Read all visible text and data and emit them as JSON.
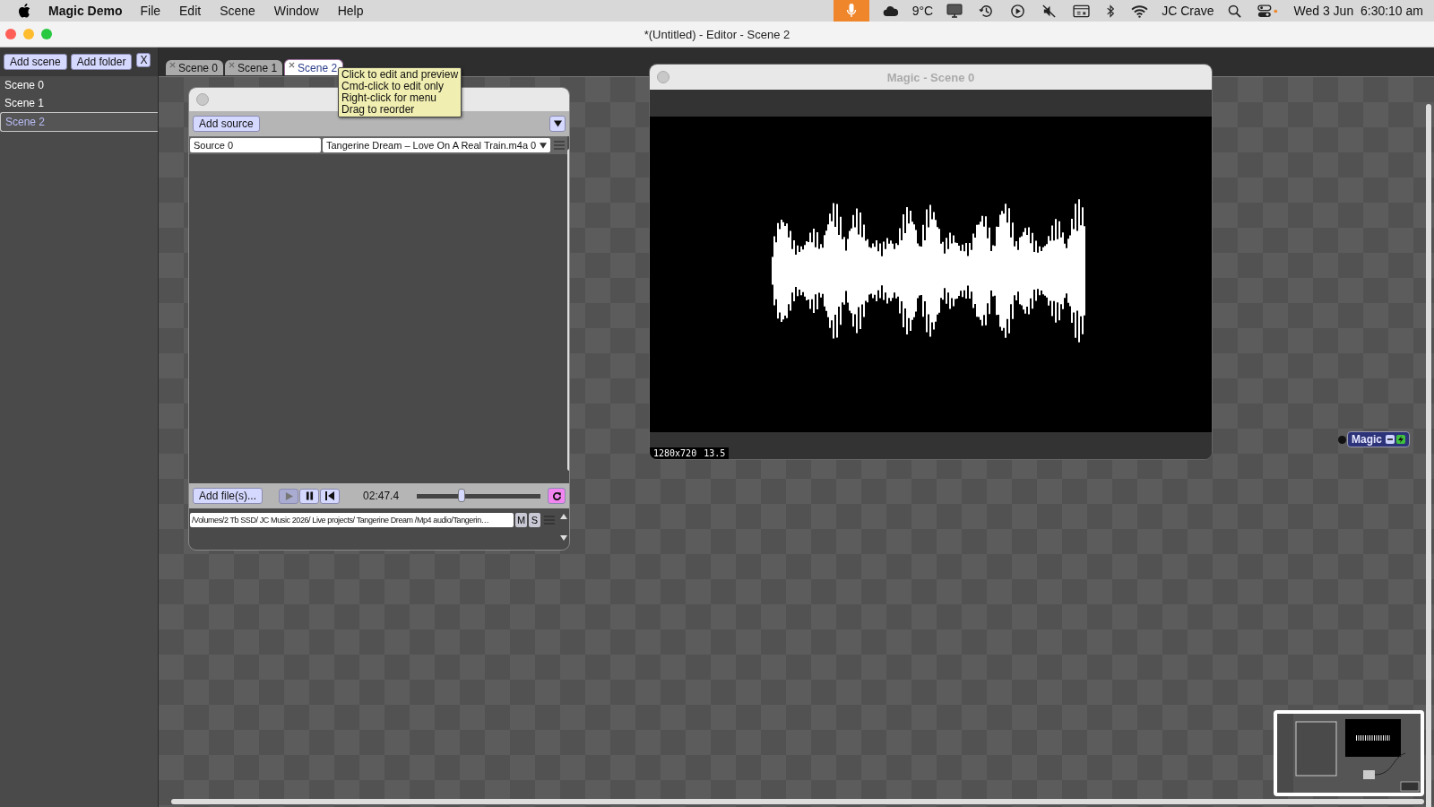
{
  "menubar": {
    "app_name": "Magic Demo",
    "menus": [
      "File",
      "Edit",
      "Scene",
      "Window",
      "Help"
    ],
    "weather": "9°C",
    "user": "JC Crave",
    "clock": "Wed 3 Jun  6:30:10 am"
  },
  "window": {
    "title": "*(Untitled) - Editor - Scene 2"
  },
  "sidebar": {
    "buttons": [
      "Add scene",
      "Add folder"
    ],
    "close_label": "X",
    "items": [
      {
        "label": "Scene 0",
        "selected": false
      },
      {
        "label": "Scene 1",
        "selected": false
      },
      {
        "label": "Scene 2",
        "selected": true
      }
    ]
  },
  "tabs": [
    {
      "label": "Scene 0",
      "selected": false
    },
    {
      "label": "Scene 1",
      "selected": false
    },
    {
      "label": "Scene 2",
      "selected": true
    }
  ],
  "tooltip": {
    "lines": [
      "Click to edit and preview",
      "Cmd-click to edit only",
      "Right-click for menu",
      "Drag to reorder"
    ]
  },
  "source_panel": {
    "add_button": "Add source",
    "source_name": "Source 0",
    "source_file": "Tangerine Dream – Love On A Real Train.m4a 0",
    "add_files": "Add file(s)...",
    "playing": true,
    "time": "02:47.4",
    "level": 0.36,
    "loop": true,
    "path": "/Volumes/2 Tb SSD/ JC Music 2026/  Live projects/ Tangerine Dream /Mp4 audio/Tangerin…",
    "mute_label": "M",
    "solo_label": "S"
  },
  "preview": {
    "title": "Magic - Scene 0",
    "resolution": "1280x720",
    "fps": "13.5"
  },
  "node": {
    "label": "Magic"
  }
}
